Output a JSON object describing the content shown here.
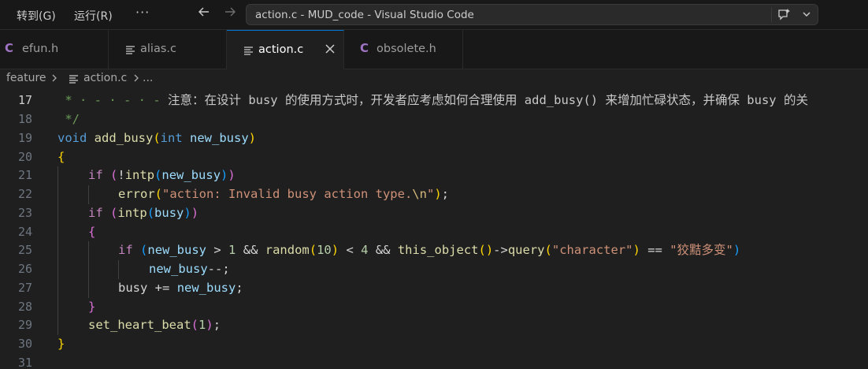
{
  "window": {
    "menu": [
      "转到(G)",
      "运行(R)"
    ],
    "more_menu": "···",
    "title": "action.c - MUD_code - Visual Studio Code"
  },
  "tabs": [
    {
      "label": "efun.h",
      "icon": "c-file-icon",
      "active": false
    },
    {
      "label": "alias.c",
      "icon": "text-file-icon",
      "active": false
    },
    {
      "label": "action.c",
      "icon": "text-file-icon",
      "active": true
    },
    {
      "label": "obsolete.h",
      "icon": "c-file-icon",
      "active": false
    }
  ],
  "breadcrumb": {
    "folder": "feature",
    "file": "action.c",
    "more": "..."
  },
  "editor": {
    "current_line": 17,
    "line_numbers": [
      "17",
      "18",
      "19",
      "20",
      "21",
      "22",
      "23",
      "24",
      "25",
      "26",
      "27",
      "28",
      "29",
      "30",
      "31"
    ],
    "code": {
      "l17_lead": " * · - · - · - ",
      "l17_text": "注意：在设计 busy 的使用方式时，开发者应考虑如何合理使用 add_busy() 来增加忙碌状态，并确保 busy 的关",
      "l18": " */",
      "l19_void": "void",
      "l19_fn": "add_busy",
      "l19_int": "int",
      "l19_param": "new_busy",
      "l20": "{",
      "l21_if": "if",
      "l21_not": "!",
      "l21_fn": "intp",
      "l21_var": "new_busy",
      "l22_fn": "error",
      "l22_str": "\"action: Invalid busy action type.",
      "l22_esc": "\\n",
      "l22_end": "\"",
      "l23_if": "if",
      "l23_fn": "intp",
      "l23_var": "busy",
      "l24": "{",
      "l25_if": "if",
      "l25_var": "new_busy",
      "l25_gt": ">",
      "l25_n1": "1",
      "l25_and": "&&",
      "l25_rand": "random",
      "l25_n10": "10",
      "l25_lt": "<",
      "l25_n4": "4",
      "l25_and2": "&&",
      "l25_this": "this_object",
      "l25_arrow": "->",
      "l25_query": "query",
      "l25_str1": "\"character\"",
      "l25_eq": "==",
      "l25_str2": "\"狡黠多变\"",
      "l26_var": "new_busy",
      "l26_op": "--;",
      "l27_var": "busy",
      "l27_op": "+=",
      "l27_var2": "new_busy",
      "l28": "}",
      "l29_fn": "set_heart_beat",
      "l29_num": "1",
      "l30": "}"
    }
  },
  "colors": {
    "accent": "#0078d4",
    "c_icon": "#a074c4"
  }
}
